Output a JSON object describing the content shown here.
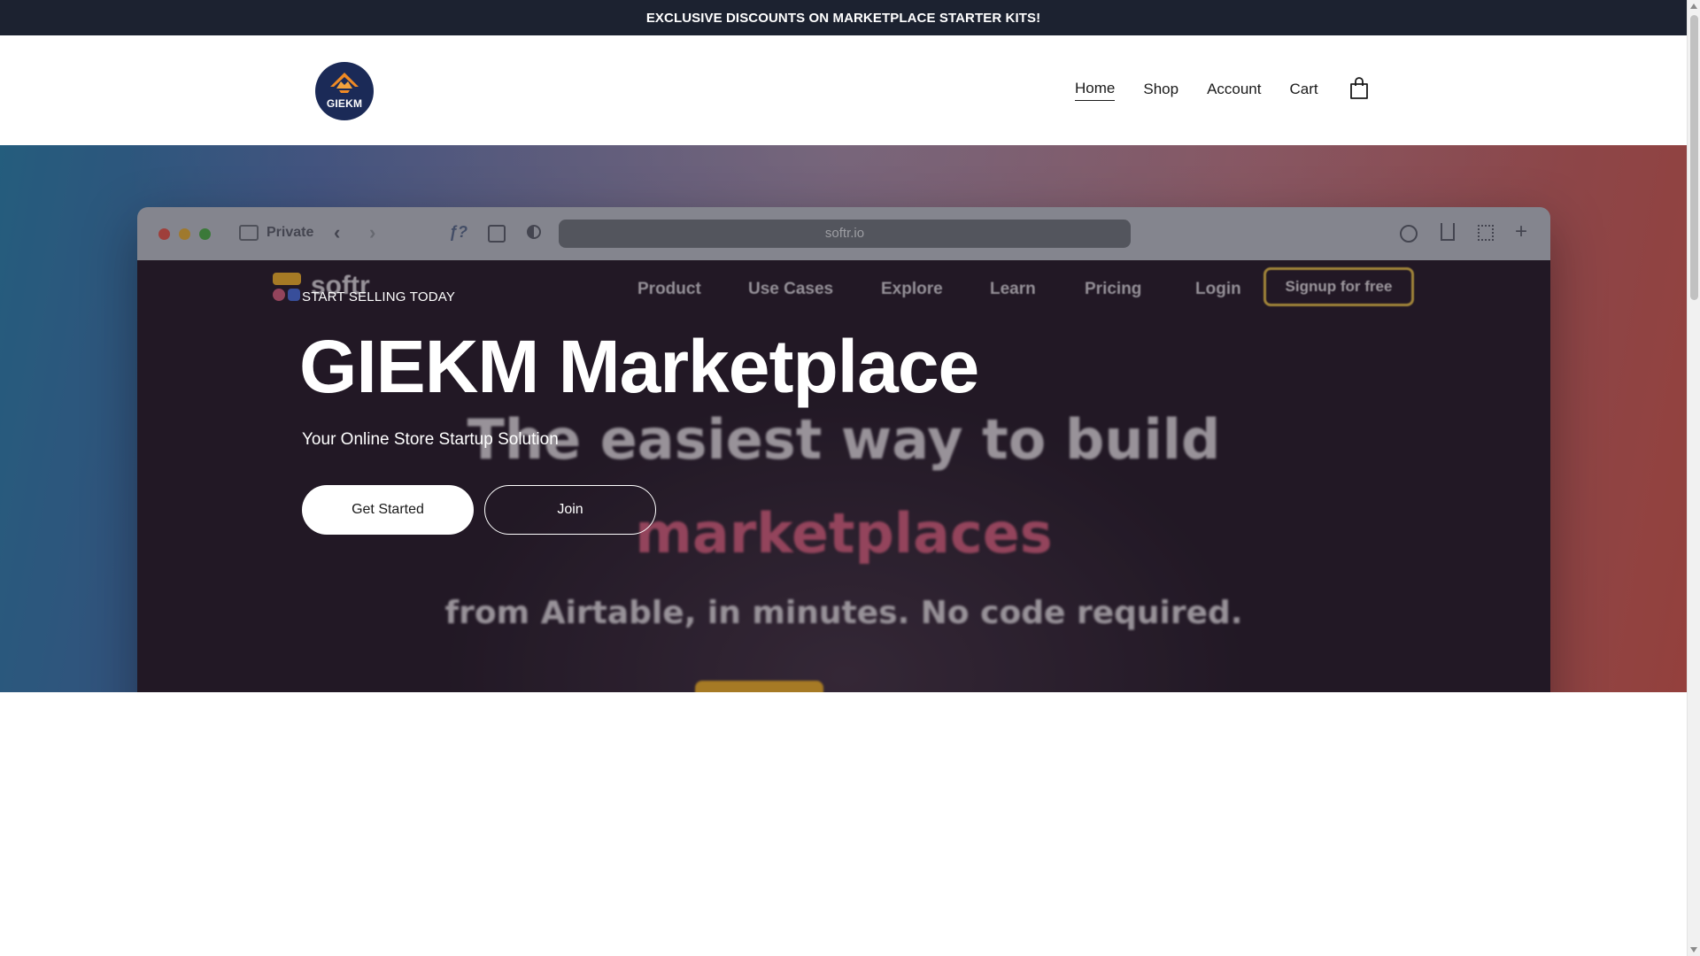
{
  "announcement": {
    "text": "EXCLUSIVE DISCOUNTS ON MARKETPLACE STARTER KITS!"
  },
  "header": {
    "logo_text": "GIEKM",
    "nav": [
      {
        "label": "Home",
        "active": true
      },
      {
        "label": "Shop",
        "active": false
      },
      {
        "label": "Account",
        "active": false
      },
      {
        "label": "Cart",
        "active": false
      }
    ],
    "cart_icon": "shopping-bag-icon"
  },
  "hero": {
    "eyebrow": "START SELLING TODAY",
    "title": "GIEKM Marketplace",
    "subtitle": "Your Online Store Startup Solution",
    "primary_button": "Get Started",
    "secondary_button": "Join",
    "background_mockup": {
      "private_label": "Private",
      "url": "softr.io",
      "brand": "softr",
      "nav": [
        "Product",
        "Use Cases",
        "Explore",
        "Learn",
        "Pricing"
      ],
      "login": "Login",
      "signup": "Signup for free",
      "headline_1": "The easiest way to build",
      "headline_2": "marketplaces",
      "headline_3": "from Airtable, in minutes. No code required."
    }
  },
  "colors": {
    "announcement_bg": "#1c2230",
    "logo_bg": "#1b2a57",
    "logo_accent": "#f08a24",
    "mock_accent": "#e2a72e",
    "mock_pink": "#c85c7a"
  }
}
